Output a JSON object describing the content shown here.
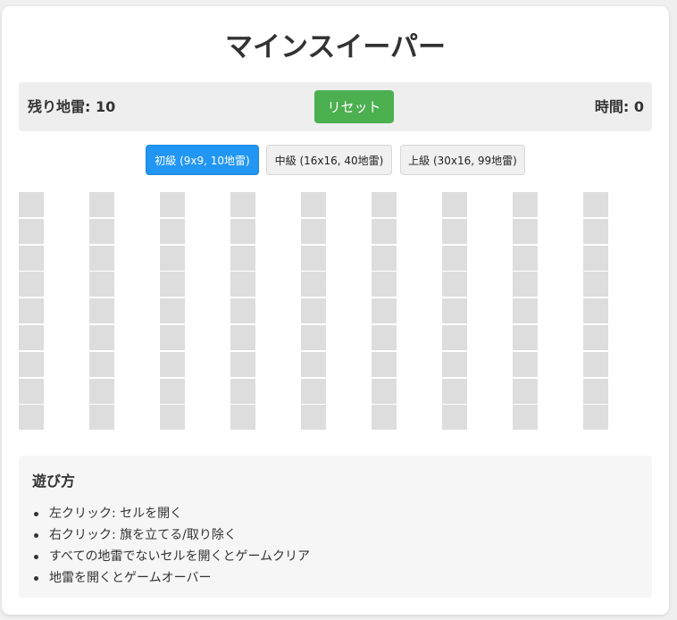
{
  "title": "マインスイーパー",
  "status": {
    "mines_left_label": "残り地雷: 10",
    "reset_label": "リセット",
    "timer_label": "時間: 0"
  },
  "difficulty": [
    {
      "label": "初級 (9x9, 10地雷)",
      "active": true
    },
    {
      "label": "中級 (16x16, 40地雷)",
      "active": false
    },
    {
      "label": "上級 (30x16, 99地雷)",
      "active": false
    }
  ],
  "board": {
    "rows": 9,
    "cols": 9,
    "cell_state": "unrevealed",
    "cell_color": "#dddddd"
  },
  "help": {
    "title": "遊び方",
    "items": [
      "左クリック: セルを開く",
      "右クリック: 旗を立てる/取り除く",
      "すべての地雷でないセルを開くとゲームクリア",
      "地雷を開くとゲームオーバー"
    ]
  },
  "colors": {
    "reset": "#4caf50",
    "active_difficulty": "#2196f3"
  }
}
